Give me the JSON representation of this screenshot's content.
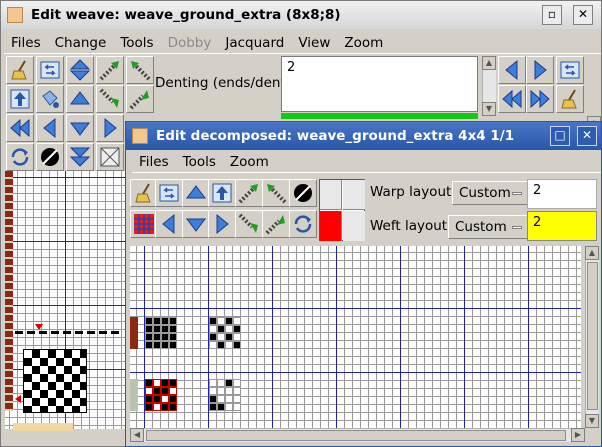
{
  "main_window": {
    "title": "Edit weave: weave_ground_extra (8x8;8)",
    "menus": [
      "Files",
      "Change",
      "Tools",
      "Dobby",
      "Jacquard",
      "View",
      "Zoom"
    ],
    "denting_label": "Denting (ends/dent)",
    "denting_value": "2",
    "window_buttons": {
      "minimize": "▫",
      "close": "✕"
    }
  },
  "sub_window": {
    "title": "Edit decomposed: weave_ground_extra 4x4 1/1",
    "menus": [
      "Files",
      "Tools",
      "Zoom"
    ],
    "warp_layout_label": "Warp layout",
    "warp_layout_value": "Custom",
    "warp_layout_number": "2",
    "weft_layout_label": "Weft layout",
    "weft_layout_value": "Custom",
    "weft_layout_number": "2",
    "window_buttons": {
      "maximize": "□",
      "close": "✕"
    }
  },
  "colors": {
    "accent_blue": "#2a56a6",
    "highlight_yellow": "#ffff00",
    "weft_red": "#ff0000",
    "denting_green": "#16c816"
  }
}
